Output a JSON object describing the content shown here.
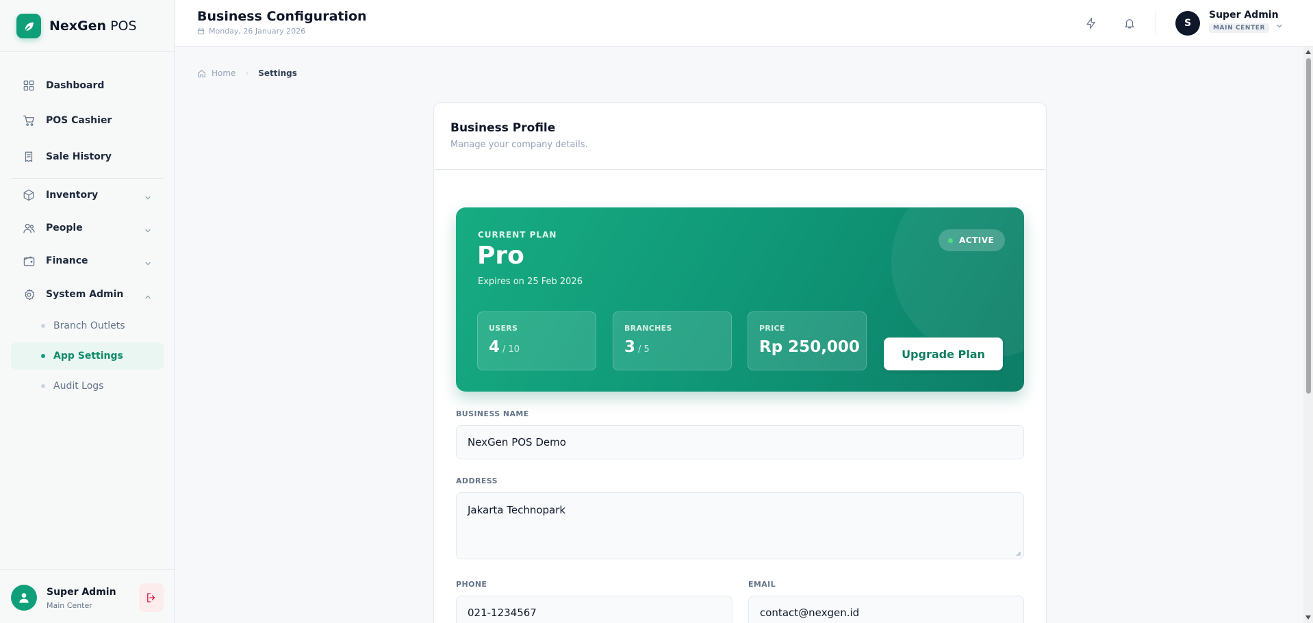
{
  "app": {
    "name_bold": "NexGen",
    "name_rest": " POS"
  },
  "sidebar": {
    "items": [
      {
        "label": "Dashboard",
        "icon": "grid-icon"
      },
      {
        "label": "POS Cashier",
        "icon": "cart-icon"
      },
      {
        "label": "Sale History",
        "icon": "receipt-icon"
      },
      {
        "label": "Inventory",
        "icon": "box-icon"
      },
      {
        "label": "People",
        "icon": "users-icon"
      },
      {
        "label": "Finance",
        "icon": "wallet-icon"
      },
      {
        "label": "System Admin",
        "icon": "gear-icon"
      }
    ],
    "subitems": [
      {
        "label": "Branch Outlets"
      },
      {
        "label": "App Settings",
        "active": true
      },
      {
        "label": "Audit Logs"
      }
    ],
    "user": {
      "name": "Super Admin",
      "location": "Main Center"
    }
  },
  "header": {
    "title": "Business Configuration",
    "date": "Monday, 26 January 2026",
    "user_initial": "S",
    "user_name": "Super Admin",
    "user_role": "MAIN CENTER"
  },
  "breadcrumb": {
    "home": "Home",
    "current": "Settings"
  },
  "card": {
    "title": "Business Profile",
    "subtitle": "Manage your company details."
  },
  "plan": {
    "label": "CURRENT PLAN",
    "name": "Pro",
    "expires": "Expires on 25 Feb 2026",
    "status": "ACTIVE",
    "stats": {
      "users": {
        "label": "USERS",
        "value": "4",
        "limit": "/ 10"
      },
      "branches": {
        "label": "BRANCHES",
        "value": "3",
        "limit": "/ 5"
      },
      "price": {
        "label": "PRICE",
        "value": "Rp 250,000"
      }
    },
    "upgrade_label": "Upgrade Plan"
  },
  "form": {
    "business_name": {
      "label": "BUSINESS NAME",
      "value": "NexGen POS Demo"
    },
    "address": {
      "label": "ADDRESS",
      "value": "Jakarta Technopark"
    },
    "phone": {
      "label": "PHONE",
      "value": "021-1234567"
    },
    "email": {
      "label": "EMAIL",
      "value": "contact@nexgen.id"
    }
  },
  "colors": {
    "brand": "#10a079",
    "plan_gradient_start": "#17ac82",
    "plan_gradient_end": "#0d7d67",
    "danger": "#e11d48"
  }
}
